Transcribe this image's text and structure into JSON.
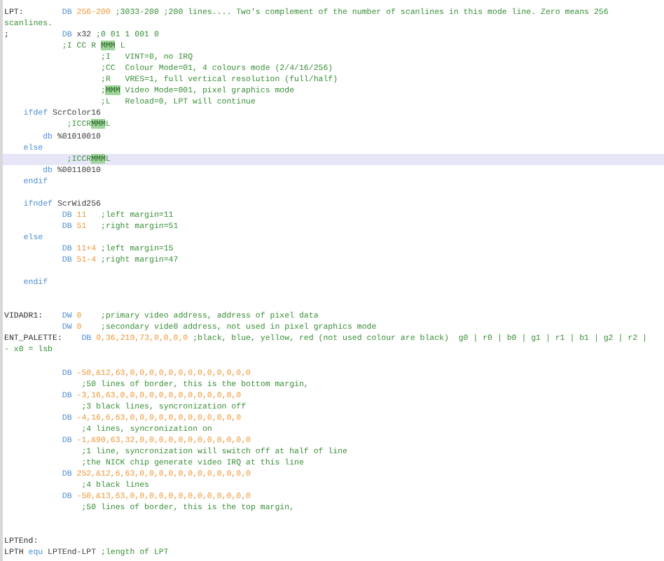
{
  "lines": [
    {
      "kind": "top",
      "current": false,
      "tokens": [
        {
          "kind": "label",
          "text": "LPT:"
        },
        {
          "kind": "keyword",
          "text": "DB"
        },
        {
          "kind": "number",
          "text": "256-200"
        },
        {
          "kind": "comment",
          "text": ";3033-200 ;200 lines.... Two's complement of the number of scanlines in this mode line. Zero means 256"
        }
      ]
    },
    {
      "kind": "top",
      "current": false,
      "tokens": [
        {
          "kind": "comment",
          "text": "scanlines."
        }
      ]
    },
    {
      "kind": "top",
      "current": false,
      "tokens": [
        {
          "kind": "label",
          "text": ";"
        },
        {
          "kind": "keyword",
          "text": "DB"
        },
        {
          "kind": "text",
          "text": "x32"
        },
        {
          "kind": "comment",
          "text": ";0 01 1 001 0"
        }
      ]
    },
    {
      "kind": "mode",
      "current": false,
      "tokens": [
        {
          "kind": "comment",
          "segments": [
            {
              "text": ";I CC R ",
              "match": false
            },
            {
              "text": "MMM",
              "match": true
            },
            {
              "text": " L",
              "match": false
            }
          ]
        }
      ]
    },
    {
      "kind": "field",
      "current": false,
      "tokens": [
        {
          "kind": "comment",
          "text": ";I   VINT=0, no IRQ"
        }
      ]
    },
    {
      "kind": "field",
      "current": false,
      "tokens": [
        {
          "kind": "comment",
          "text": ";CC  Colour Mode=01, 4 colours mode (2/4/16/256)"
        }
      ]
    },
    {
      "kind": "field",
      "current": false,
      "tokens": [
        {
          "kind": "comment",
          "text": ";R   VRES=1, full vertical resolution (full/half)"
        }
      ]
    },
    {
      "kind": "field",
      "current": false,
      "tokens": [
        {
          "kind": "comment",
          "segments": [
            {
              "text": ";",
              "match": false
            },
            {
              "text": "MMM",
              "match": true
            },
            {
              "text": " Video Mode=001, pixel graphics mode",
              "match": false
            }
          ]
        }
      ]
    },
    {
      "kind": "field",
      "current": false,
      "tokens": [
        {
          "kind": "comment",
          "text": ";L   Reload=0, LPT will continue"
        }
      ]
    },
    {
      "kind": "block",
      "current": false,
      "tokens": [
        {
          "kind": "keyword",
          "text": "ifdef"
        },
        {
          "kind": "text",
          "text": "ScrColor16"
        }
      ]
    },
    {
      "kind": "sub",
      "current": false,
      "tokens": [
        {
          "kind": "comment",
          "segments": [
            {
              "text": ";ICCR",
              "match": false
            },
            {
              "text": "MMM",
              "match": true
            },
            {
              "text": "L",
              "match": false
            }
          ]
        }
      ]
    },
    {
      "kind": "db",
      "current": false,
      "tokens": [
        {
          "kind": "keyword",
          "text": "db"
        },
        {
          "kind": "text",
          "text": "%01010010"
        }
      ]
    },
    {
      "kind": "block",
      "current": false,
      "tokens": [
        {
          "kind": "keyword",
          "text": "else"
        }
      ]
    },
    {
      "kind": "sub",
      "current": true,
      "tokens": [
        {
          "kind": "comment",
          "segments": [
            {
              "text": ";ICCR",
              "match": false
            },
            {
              "text": "MMM",
              "match": true
            },
            {
              "text": "L",
              "match": false
            }
          ]
        }
      ]
    },
    {
      "kind": "db",
      "current": false,
      "tokens": [
        {
          "kind": "keyword",
          "text": "db"
        },
        {
          "kind": "text",
          "text": "%00110010"
        }
      ]
    },
    {
      "kind": "block",
      "current": false,
      "tokens": [
        {
          "kind": "keyword",
          "text": "endif"
        }
      ]
    },
    {
      "kind": "blank",
      "current": false
    },
    {
      "kind": "block",
      "current": false,
      "tokens": [
        {
          "kind": "keyword",
          "text": "ifndef"
        },
        {
          "kind": "text",
          "text": "ScrWid256"
        }
      ]
    },
    {
      "kind": "mode",
      "current": false,
      "tokens": [
        {
          "kind": "keyword",
          "text": "DB"
        },
        {
          "kind": "number",
          "text": "11"
        },
        {
          "kind": "comment",
          "text": ";left margin=11",
          "align": true
        }
      ]
    },
    {
      "kind": "mode",
      "current": false,
      "tokens": [
        {
          "kind": "keyword",
          "text": "DB"
        },
        {
          "kind": "number",
          "text": "51"
        },
        {
          "kind": "comment",
          "text": ";right margin=51",
          "align": true
        }
      ]
    },
    {
      "kind": "block",
      "current": false,
      "tokens": [
        {
          "kind": "keyword",
          "text": "else"
        }
      ]
    },
    {
      "kind": "mode",
      "current": false,
      "tokens": [
        {
          "kind": "keyword",
          "text": "DB"
        },
        {
          "kind": "number",
          "text": "11+4"
        },
        {
          "kind": "comment",
          "text": ";left margin=15"
        }
      ]
    },
    {
      "kind": "mode",
      "current": false,
      "tokens": [
        {
          "kind": "keyword",
          "text": "DB"
        },
        {
          "kind": "number",
          "text": "51-4"
        },
        {
          "kind": "comment",
          "text": ";right margin=47"
        }
      ]
    },
    {
      "kind": "blank",
      "current": false
    },
    {
      "kind": "block",
      "current": false,
      "tokens": [
        {
          "kind": "keyword",
          "text": "endif"
        }
      ]
    },
    {
      "kind": "blank",
      "current": false
    },
    {
      "kind": "blank",
      "current": false
    },
    {
      "kind": "top",
      "current": false,
      "tokens": [
        {
          "kind": "label",
          "text": "VIDADR1:"
        },
        {
          "kind": "keyword",
          "text": "DW"
        },
        {
          "kind": "number",
          "text": "0"
        },
        {
          "kind": "comment",
          "text": ";primary video address, address of pixel data",
          "align": true
        }
      ]
    },
    {
      "kind": "mode",
      "current": false,
      "tokens": [
        {
          "kind": "keyword",
          "text": "DW"
        },
        {
          "kind": "number",
          "text": "0"
        },
        {
          "kind": "comment",
          "text": ";secondary vide0 address, not used in pixel graphics mode",
          "align": true
        }
      ]
    },
    {
      "kind": "top",
      "current": false,
      "tokens": [
        {
          "kind": "label",
          "text": "ENT_PALETTE:"
        },
        {
          "kind": "keyword",
          "text": "DB"
        },
        {
          "kind": "number",
          "text": "0,36,219,73,0,0,0,0"
        },
        {
          "kind": "comment",
          "text": ";black, blue, yellow, red (not used colour are black)  g0 | r0 | b0 | g1 | r1 | b1 | g2 | r2 |"
        }
      ]
    },
    {
      "kind": "top",
      "current": false,
      "tokens": [
        {
          "kind": "comment",
          "text": "- x0 = lsb"
        }
      ]
    },
    {
      "kind": "blank",
      "current": false
    },
    {
      "kind": "mode",
      "current": false,
      "tokens": [
        {
          "kind": "keyword",
          "text": "DB"
        },
        {
          "kind": "number",
          "text": "-50,&12,63,0,0,0,0,0,0,0,0,0,0,0,0,0"
        }
      ]
    },
    {
      "kind": "note",
      "current": false,
      "tokens": [
        {
          "kind": "comment",
          "text": ";50 lines of border, this is the bottom margin,"
        }
      ]
    },
    {
      "kind": "mode",
      "current": false,
      "tokens": [
        {
          "kind": "keyword",
          "text": "DB"
        },
        {
          "kind": "number",
          "text": "-3,16,63,0,0,0,0,0,0,0,0,0,0,0,0,0"
        }
      ]
    },
    {
      "kind": "note",
      "current": false,
      "tokens": [
        {
          "kind": "comment",
          "text": ";3 black lines, syncronization off"
        }
      ]
    },
    {
      "kind": "mode",
      "current": false,
      "tokens": [
        {
          "kind": "keyword",
          "text": "DB"
        },
        {
          "kind": "number",
          "text": "-4,16,6,63,0,0,0,0,0,0,0,0,0,0,0,0"
        }
      ]
    },
    {
      "kind": "note",
      "current": false,
      "tokens": [
        {
          "kind": "comment",
          "text": ";4 lines, syncronization on"
        }
      ]
    },
    {
      "kind": "mode",
      "current": false,
      "tokens": [
        {
          "kind": "keyword",
          "text": "DB"
        },
        {
          "kind": "number",
          "text": "-1,&90,63,32,0,0,0,0,0,0,0,0,0,0,0,0"
        }
      ]
    },
    {
      "kind": "note",
      "current": false,
      "tokens": [
        {
          "kind": "comment",
          "text": ";1 line, syncronization will switch off at half of line"
        }
      ]
    },
    {
      "kind": "note",
      "current": false,
      "tokens": [
        {
          "kind": "comment",
          "text": ";the NICK chip generate video IRQ at this line"
        }
      ]
    },
    {
      "kind": "mode",
      "current": false,
      "tokens": [
        {
          "kind": "keyword",
          "text": "DB"
        },
        {
          "kind": "number",
          "text": "252,&12,6,63,0,0,0,0,0,0,0,0,0,0,0,0"
        }
      ]
    },
    {
      "kind": "note",
      "current": false,
      "tokens": [
        {
          "kind": "comment",
          "text": ";4 black lines"
        }
      ]
    },
    {
      "kind": "mode",
      "current": false,
      "tokens": [
        {
          "kind": "keyword",
          "text": "DB"
        },
        {
          "kind": "number",
          "text": "-50,&13,63,0,0,0,0,0,0,0,0,0,0,0,0,0"
        }
      ]
    },
    {
      "kind": "note",
      "current": false,
      "tokens": [
        {
          "kind": "comment",
          "text": ";50 lines of border, this is the top margin,"
        }
      ]
    },
    {
      "kind": "blank",
      "current": false
    },
    {
      "kind": "blank",
      "current": false
    },
    {
      "kind": "top",
      "current": false,
      "tokens": [
        {
          "kind": "label",
          "text": "LPTEnd:"
        }
      ]
    },
    {
      "kind": "plain",
      "current": false,
      "tokens": [
        {
          "kind": "label",
          "text": "LPTH"
        },
        {
          "kind": "keyword",
          "text": "equ"
        },
        {
          "kind": "text",
          "text": "LPTEnd-LPT"
        },
        {
          "kind": "comment",
          "text": ";length of LPT"
        }
      ]
    }
  ]
}
